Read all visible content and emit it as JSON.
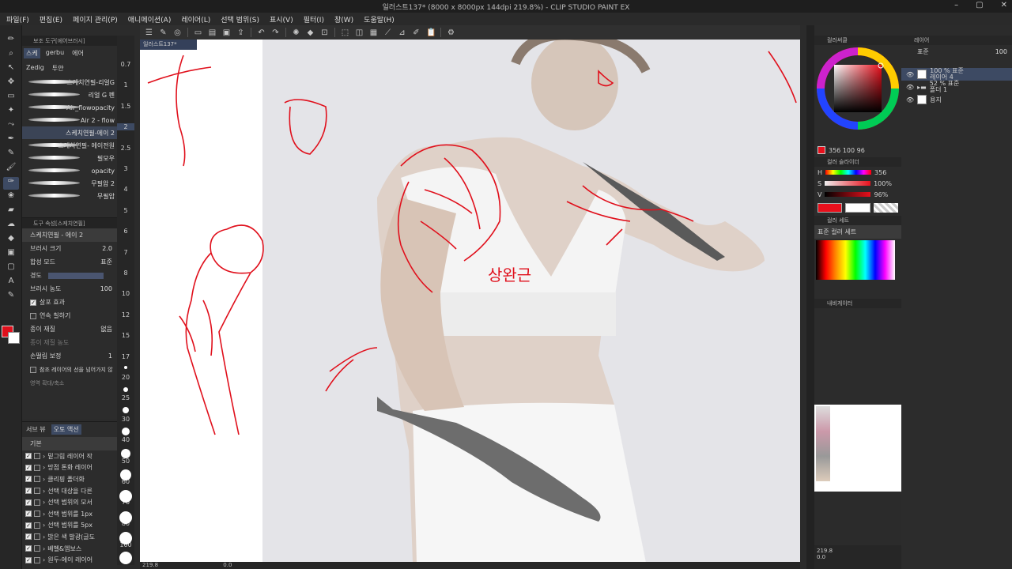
{
  "window": {
    "title": "일러스트137* (8000 x 8000px 144dpi 219.8%) - CLIP STUDIO PAINT EX"
  },
  "menu": [
    "파일(F)",
    "편집(E)",
    "페이지 관리(P)",
    "애니메이션(A)",
    "레이어(L)",
    "선택 범위(S)",
    "표시(V)",
    "필터(I)",
    "창(W)",
    "도움말(H)"
  ],
  "subtool": {
    "header": "보조 도구[에어브러시]",
    "tabs": [
      "스케",
      "gerbu",
      "에어",
      "Zedig",
      "투얀"
    ],
    "brushes": [
      "스케치연필-리얼G",
      "리얼 G 펜",
      "Air_flowopacity",
      "Air 2 - flow",
      "스케치연필-에이 2",
      "스케치연필- 에이전원",
      "필모우",
      "opacity",
      "무필압 2",
      "무필압"
    ]
  },
  "toolprop": {
    "header": "도구 속성[스케치연필]",
    "preset": "스케치연필 - 에이 2",
    "brush_size_label": "브러시 크기",
    "brush_size": "2.0",
    "blend_label": "합성 모드",
    "blend": "표준",
    "hardness_label": "경도",
    "density_label": "브러시 농도",
    "density": "100",
    "spray_label": "살포 효과",
    "continuous_label": "연속 칠하기",
    "paper_label": "종이 재질",
    "paper": "없음",
    "paper_density_label": "종이 재질 농도",
    "stabilize_label": "손떨림 보정",
    "stabilize": "1",
    "ref_label": "참조 레이어의 선을 넘어가지 않",
    "expand_label": "영역 확대/축소"
  },
  "sizes": [
    "0.7",
    "1",
    "1.5",
    "2",
    "2.5",
    "3",
    "4",
    "5",
    "6",
    "7",
    "8",
    "10",
    "12",
    "15",
    "17",
    "20",
    "25",
    "30",
    "40",
    "50",
    "60",
    "70",
    "80",
    "100"
  ],
  "autoaction": {
    "tabs": [
      "서브 뷰",
      "오토 액션"
    ],
    "set": "기본",
    "items": [
      "밑그림 레이어 작",
      "망점 톤화 레이어",
      "클리핑 폴더화",
      "선택 대상을 다른",
      "선택 범위의 모서",
      "선택 범위를 1px",
      "선택 범위를 5px",
      "밝은 색 발광(글도",
      "베벨&엠보스",
      "원두-에이 레이어"
    ]
  },
  "canvas": {
    "tab": "일러스트137*",
    "annotation": "상완근"
  },
  "status": {
    "zoom": "219.8",
    "angle": "0.0"
  },
  "color": {
    "header": "컬러써클",
    "hsv": "356 100 96",
    "h_label": "H",
    "h_value": "356",
    "s_label": "S",
    "s_value": "100%",
    "v_label": "V",
    "v_value": "96%",
    "slider_header": "컬러 슬라이더",
    "set_header": "컬러 세트",
    "set_name": "표준 컬러 세트",
    "nav_header": "내비게이터",
    "main_color": "#e8101c",
    "hue_deg": 356
  },
  "layer": {
    "header": "레이어",
    "blend": "표준",
    "opacity": "100",
    "items": [
      {
        "pct": "100 % 표준",
        "name": "레이어 4"
      },
      {
        "pct": "52 % 표준",
        "name": "폴더 1"
      },
      {
        "pct": "",
        "name": "용지"
      }
    ]
  },
  "navigator": {
    "zoom": "219.8",
    "angle": "0.0"
  }
}
